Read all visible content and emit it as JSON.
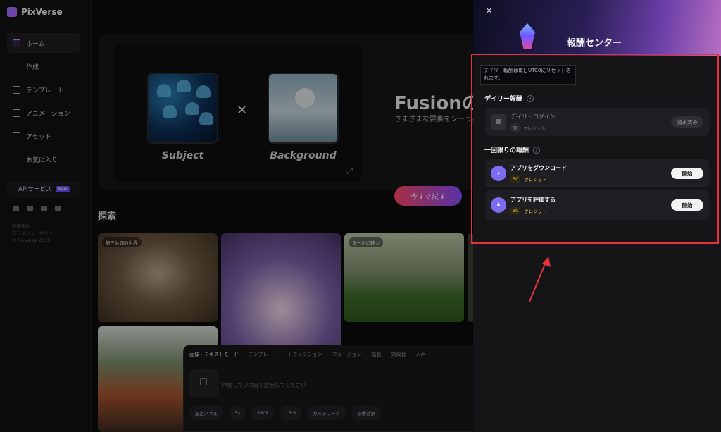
{
  "app": {
    "name": "PixVerse"
  },
  "sidebar": {
    "items": [
      {
        "label": "ホーム",
        "icon": "home-icon",
        "active": true
      },
      {
        "label": "作成",
        "icon": "video-icon"
      },
      {
        "label": "テンプレート",
        "icon": "sparkle-icon"
      },
      {
        "label": "アニメーション",
        "icon": "animation-icon"
      },
      {
        "label": "アセット",
        "icon": "folder-icon"
      },
      {
        "label": "お気に入り",
        "icon": "heart-icon"
      }
    ],
    "api_label": "APIサービス",
    "api_badge": "New",
    "socials": [
      "tiktok-icon",
      "x-icon",
      "youtube-icon",
      "discord-icon"
    ],
    "legal": [
      "利用規約",
      "プライバシーポリシー",
      "© PixVerse 2025"
    ]
  },
  "hero": {
    "subject_label": "Subject",
    "background_label": "Background",
    "title": "Fusionの",
    "subtitle": "さまざまな要素をシーう。",
    "try_button": "今すぐ試す"
  },
  "explore": {
    "title": "探索",
    "images": [
      {
        "tag": "第三共同の世界",
        "subject": "hamster"
      },
      {
        "tag": "",
        "subject": "anime-girl"
      },
      {
        "tag": "ヌーボの魅力",
        "subject": "dog"
      },
      {
        "tag": "",
        "subject": "tiger"
      }
    ]
  },
  "prompt_bar": {
    "modes": [
      "画像・テキストモード",
      "テンプレート",
      "トランジション",
      "フュージョン",
      "拡張",
      "効果音",
      "人声"
    ],
    "placeholder": "作成したい内容を説明してください",
    "tools": [
      "設定パネル",
      "5s",
      "360P",
      "16:9",
      "カメラワーク",
      "音響効果",
      "音声"
    ]
  },
  "reward_panel": {
    "title": "報酬センター",
    "tooltip": "デイリー報酬は毎日UTC0にリセットされます。",
    "daily_section": "デイリー報酬",
    "daily_items": [
      {
        "title": "デイリーログイン",
        "credits": "限",
        "credit_unit": "クレジット",
        "button": "請求済み",
        "icon": "calendar-icon"
      }
    ],
    "once_section": "一回限りの報酬",
    "once_items": [
      {
        "title": "アプリをダウンロード",
        "credits": "30",
        "credit_unit": "クレジット",
        "button": "開始",
        "icon": "download-icon"
      },
      {
        "title": "アプリを評価する",
        "credits": "30",
        "credit_unit": "クレジット",
        "button": "開始",
        "icon": "star-icon"
      }
    ],
    "accent_color": "#7c6cf0",
    "highlight_color": "#e2343a"
  }
}
